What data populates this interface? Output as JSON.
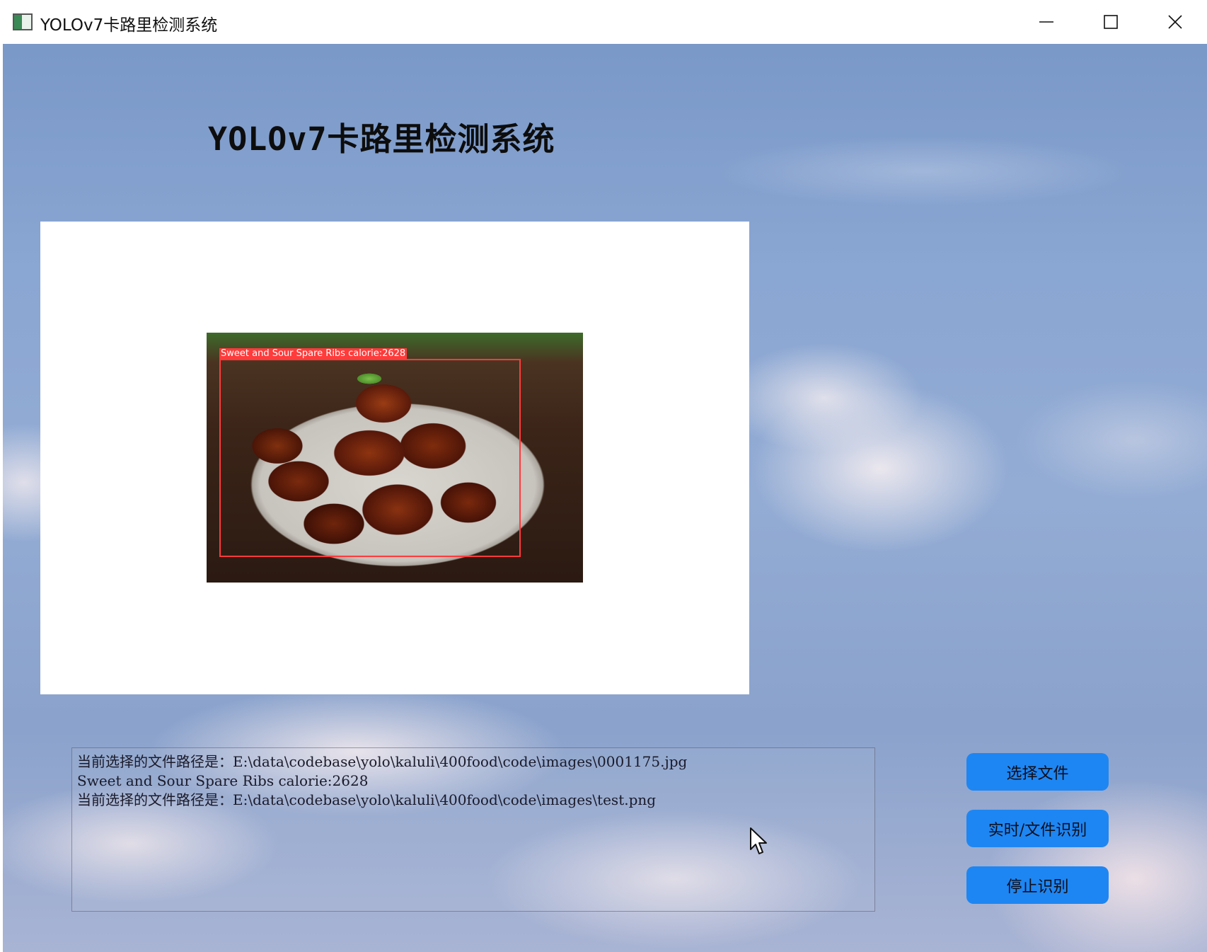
{
  "window": {
    "title": "YOLOv7卡路里检测系统"
  },
  "main": {
    "page_title": "YOLOv7卡路里检测系统",
    "detection": {
      "label": "Sweet and Sour Spare Ribs calorie:2628",
      "box_color": "#ff3b3b"
    },
    "log_lines": [
      "当前选择的文件路径是：E:\\data\\codebase\\yolo\\kaluli\\400food\\code\\images\\0001175.jpg",
      "Sweet and Sour Spare Ribs calorie:2628",
      "当前选择的文件路径是：E:\\data\\codebase\\yolo\\kaluli\\400food\\code\\images\\test.png"
    ]
  },
  "buttons": {
    "select_file": "选择文件",
    "realtime_detect": "实时/文件识别",
    "stop_detect": "停止识别"
  },
  "colors": {
    "button_blue": "#1e86f2",
    "sky_blue": "#8aa6d2"
  },
  "icons": {
    "app": "app-window-icon",
    "minimize": "minimize-icon",
    "maximize": "maximize-icon",
    "close": "close-icon",
    "cursor": "mouse-pointer-icon"
  }
}
